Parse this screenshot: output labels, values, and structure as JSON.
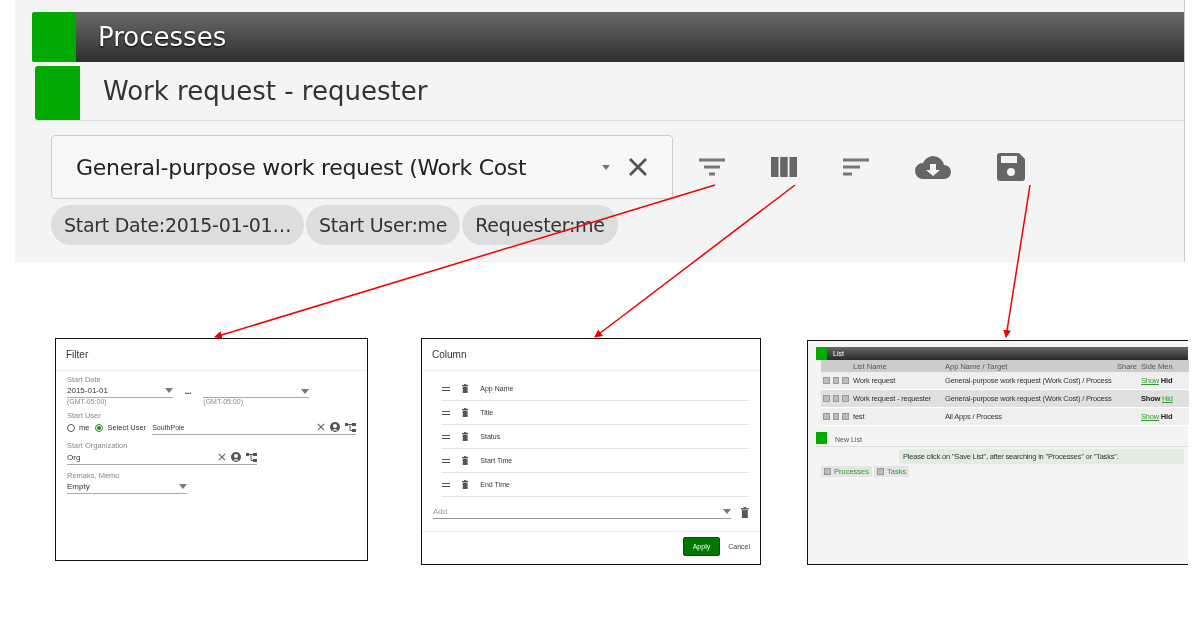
{
  "header": {
    "title": "Processes"
  },
  "list_header": {
    "title": "Work request - requester"
  },
  "search": {
    "value": "General-purpose work request (Work Cost"
  },
  "chips": [
    "Start Date:2015-01-01…",
    "Start User:me",
    "Requester:me"
  ],
  "filter_panel": {
    "title": "Filter",
    "start_date": {
      "label": "Start Date",
      "from": "2015-01-01",
      "separator": "•••",
      "from_zone": "(GMT-05:00)",
      "to_zone": "(GMT-05:00)"
    },
    "start_user": {
      "label": "Start User",
      "options": [
        {
          "label": "me",
          "selected": false
        },
        {
          "label": "Select User",
          "selected": true
        }
      ],
      "value": "SouthPole"
    },
    "start_org": {
      "label": "Start Organization",
      "value": "Org"
    },
    "memo": {
      "label": "Remaks, Memo",
      "value": "Empty"
    }
  },
  "column_panel": {
    "title": "Column",
    "columns": [
      "App Name",
      "Title",
      "Status",
      "Start Time",
      "End Time"
    ],
    "add_placeholder": "Add",
    "buttons": [
      {
        "label": "Apply",
        "kind": "primary"
      },
      {
        "label": "Cancel",
        "kind": "plain"
      }
    ]
  },
  "list_panel": {
    "title": "List",
    "columns": [
      "List Name",
      "App Name / Target",
      "Share",
      "Side Men"
    ],
    "rows": [
      {
        "name": "Work request",
        "target": "General-purpose work request (Work Cost) / Process",
        "show": "Show",
        "hide": "Hid",
        "shown": false,
        "selected": false
      },
      {
        "name": "Work request - requester",
        "target": "General-purpose work request (Work Cost) / Process",
        "show": "Show",
        "hide": "Hid",
        "shown": true,
        "selected": true
      },
      {
        "name": "test",
        "target": "All Apps / Process",
        "show": "Show",
        "hide": "Hid",
        "shown": false,
        "selected": false
      }
    ],
    "new_list": {
      "title": "New List",
      "message": "Please click on \"Save List\", after searching in \"Processes\" or \"Tasks\".",
      "buttons": [
        "Processes",
        "Tasks"
      ]
    }
  }
}
